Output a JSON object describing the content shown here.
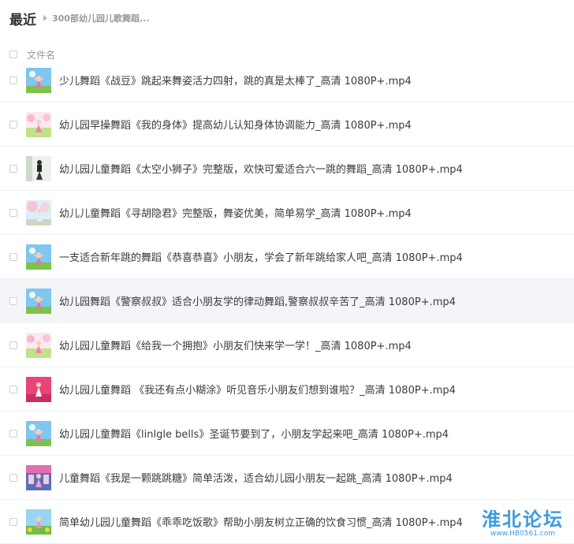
{
  "header": {
    "title": "最近",
    "breadcrumb": "300部幼儿园儿歌舞蹈..."
  },
  "list_header": {
    "column_label": "文件名"
  },
  "files": [
    {
      "name": "少儿舞蹈《战豆》跳起来舞姿活力四射，跳的真是太棒了_高清 1080P+.mp4",
      "thumb": "kid-dance-sky"
    },
    {
      "name": "幼儿园早操舞蹈《我的身体》提高幼儿认知身体协调能力_高清 1080P+.mp4",
      "thumb": "pink-flowers"
    },
    {
      "name": "幼儿园儿童舞蹈《太空小狮子》完整版，欢快可爱适合六一跳的舞蹈_高清 1080P+.mp4",
      "thumb": "dancer-white"
    },
    {
      "name": "幼儿儿童舞蹈《寻胡隐君》完整版，舞姿优美，简单易学_高清 1080P+.mp4",
      "thumb": "blossom-tree"
    },
    {
      "name": "一支适合新年跳的舞蹈《恭喜恭喜》小朋友，学会了新年跳给家人吧_高清 1080P+.mp4",
      "thumb": "kid-dance-sky"
    },
    {
      "name": "幼儿园舞蹈《警察叔叔》适合小朋友学的律动舞蹈,警察叔叔辛苦了_高清 1080P+.mp4",
      "thumb": "kid-dance-sky"
    },
    {
      "name": "幼儿园儿童舞蹈《给我一个拥抱》小朋友们快来学一学！_高清 1080P+.mp4",
      "thumb": "pink-flowers"
    },
    {
      "name": "幼儿园儿童舞蹈 《我还有点小糊涂》听见音乐小朋友们想到谁啦？_高清 1080P+.mp4",
      "thumb": "pink-stage"
    },
    {
      "name": "幼儿园儿童舞蹈《linlgle bells》圣诞节要到了，小朋友学起来吧_高清 1080P+.mp4",
      "thumb": "kid-dance-sky"
    },
    {
      "name": "儿童舞蹈《我是一颗跳跳糖》简单活泼，适合幼儿园小朋友一起跳_高清 1080P+.mp4",
      "thumb": "stage-pink-blue"
    },
    {
      "name": "简单幼儿园儿童舞蹈《乖乖吃饭歌》帮助小朋友树立正确的饮食习惯_高清 1080P+.mp4",
      "thumb": "kid-dance-green"
    }
  ],
  "highlighted_row": 5,
  "watermark": {
    "title": "淮北论坛",
    "url": "www.HB0561.com"
  },
  "colors": {
    "highlight_row": "#f4f5f9",
    "divider": "#f1f2f4",
    "watermark": "#3d9be0"
  }
}
